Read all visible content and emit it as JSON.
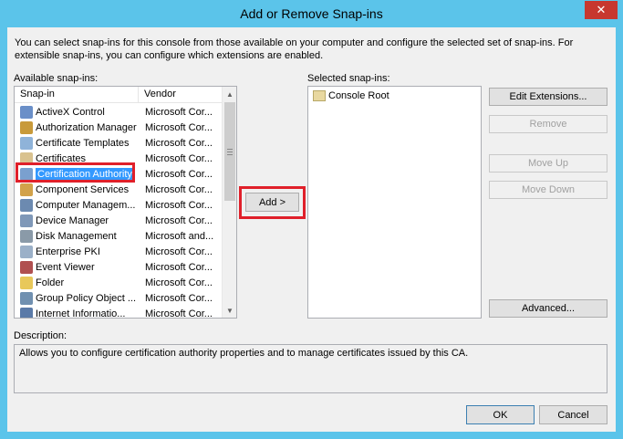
{
  "window": {
    "title": "Add or Remove Snap-ins",
    "close_glyph": "✕"
  },
  "intro_text": "You can select snap-ins for this console from those available on your computer and configure the selected set of snap-ins. For extensible snap-ins, you can configure which extensions are enabled.",
  "available": {
    "label": "Available snap-ins:",
    "columns": [
      "Snap-in",
      "Vendor"
    ],
    "rows": [
      {
        "name": "ActiveX Control",
        "vendor": "Microsoft Cor...",
        "icon": "activex-icon",
        "color": "#6a8fc8"
      },
      {
        "name": "Authorization Manager",
        "vendor": "Microsoft Cor...",
        "icon": "authorization-icon",
        "color": "#c89a3a"
      },
      {
        "name": "Certificate Templates",
        "vendor": "Microsoft Cor...",
        "icon": "certificate-templates-icon",
        "color": "#8fb3d9"
      },
      {
        "name": "Certificates",
        "vendor": "Microsoft Cor...",
        "icon": "certificates-icon",
        "color": "#d9c28f"
      },
      {
        "name": "Certification Authority",
        "vendor": "Microsoft Cor...",
        "icon": "certification-authority-icon",
        "color": "#7aa0cf",
        "selected": true
      },
      {
        "name": "Component Services",
        "vendor": "Microsoft Cor...",
        "icon": "component-services-icon",
        "color": "#d2a24a"
      },
      {
        "name": "Computer Managem...",
        "vendor": "Microsoft Cor...",
        "icon": "computer-management-icon",
        "color": "#6c8ab0"
      },
      {
        "name": "Device Manager",
        "vendor": "Microsoft Cor...",
        "icon": "device-manager-icon",
        "color": "#7f98b8"
      },
      {
        "name": "Disk Management",
        "vendor": "Microsoft and...",
        "icon": "disk-management-icon",
        "color": "#8a9aa8"
      },
      {
        "name": "Enterprise PKI",
        "vendor": "Microsoft Cor...",
        "icon": "enterprise-pki-icon",
        "color": "#9bb0c8"
      },
      {
        "name": "Event Viewer",
        "vendor": "Microsoft Cor...",
        "icon": "event-viewer-icon",
        "color": "#b05050"
      },
      {
        "name": "Folder",
        "vendor": "Microsoft Cor...",
        "icon": "folder-icon",
        "color": "#e8c85a"
      },
      {
        "name": "Group Policy Object ...",
        "vendor": "Microsoft Cor...",
        "icon": "group-policy-icon",
        "color": "#7090b0"
      },
      {
        "name": "Internet Informatio...",
        "vendor": "Microsoft Cor...",
        "icon": "iis-icon",
        "color": "#5a7aa8"
      }
    ]
  },
  "add_button_label": "Add >",
  "selected": {
    "label": "Selected snap-ins:",
    "items": [
      "Console Root"
    ]
  },
  "side_buttons": {
    "edit_extensions": "Edit Extensions...",
    "remove": "Remove",
    "move_up": "Move Up",
    "move_down": "Move Down",
    "advanced": "Advanced..."
  },
  "description": {
    "label": "Description:",
    "text": "Allows you to configure certification authority  properties and to manage certificates issued by this CA."
  },
  "footer": {
    "ok": "OK",
    "cancel": "Cancel"
  },
  "colors": {
    "title_bar": "#5bc4ea",
    "close": "#c7372f",
    "selection": "#3399ff",
    "highlight_box": "#e0202a"
  }
}
